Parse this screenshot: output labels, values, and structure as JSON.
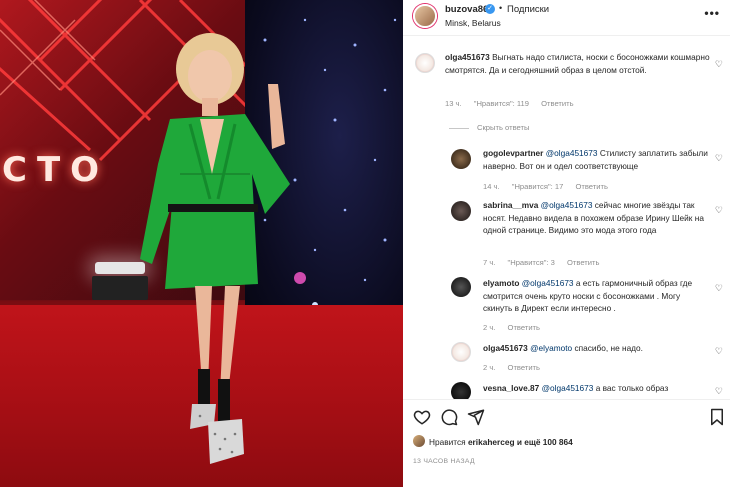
{
  "post": {
    "username": "buzova86",
    "verified_mark": "✓",
    "separator": "•",
    "follow_label": "Подписки",
    "location": "Minsk, Belarus",
    "more_label": "•••"
  },
  "photo": {
    "stage_text": "СТО"
  },
  "comments": [
    {
      "user": "olga451673",
      "text": "Выгнать надо стилиста, носки с босоножками кошмарно смотрятся. Да и сегодняшний образ в целом отстой.",
      "time": "13 ч.",
      "likes": "\"Нравится\": 119",
      "reply": "Ответить"
    },
    {
      "user": "gogolevpartner",
      "mention": "@olga451673",
      "text": "Стилисту заплатить забыли наверно. Вот он и одел соответствующе",
      "time": "14 ч.",
      "likes": "\"Нравится\": 17",
      "reply": "Ответить"
    },
    {
      "user": "sabrina__mva",
      "mention": "@olga451673",
      "text": "сейчас многие звёзды так носят. Недавно видела в похожем образе Ирину Шейк на одной странице. Видимо это мода этого года",
      "time": "7 ч.",
      "likes": "\"Нравится\": 3",
      "reply": "Ответить"
    },
    {
      "user": "elyamoto",
      "mention": "@olga451673",
      "text": "а есть гармоничный образ где смотрится очень круто носки с босоножками . Могу скинуть в Директ если интересно .",
      "time": "2 ч.",
      "reply": "Ответить"
    },
    {
      "user": "olga451673",
      "mention": "@elyamoto",
      "text": "спасибо, не надо.",
      "time": "2 ч.",
      "reply": "Ответить"
    },
    {
      "user": "vesna_love.87",
      "mention": "@olga451673",
      "text": "а вас только образ"
    }
  ],
  "hide_replies_label": "Скрыть ответы",
  "likes": {
    "prefix": "Нравится",
    "user": "erikaherceg",
    "suffix": "и ещё 100 864"
  },
  "timestamp": "13 ЧАСОВ НАЗАД",
  "icons": [
    "heart-icon",
    "comment-icon",
    "share-icon",
    "bookmark-icon",
    "more-icon",
    "verified-icon"
  ],
  "colors": {
    "verified": "#3897f0",
    "mention": "#00376b",
    "muted": "#8e8e8e"
  }
}
